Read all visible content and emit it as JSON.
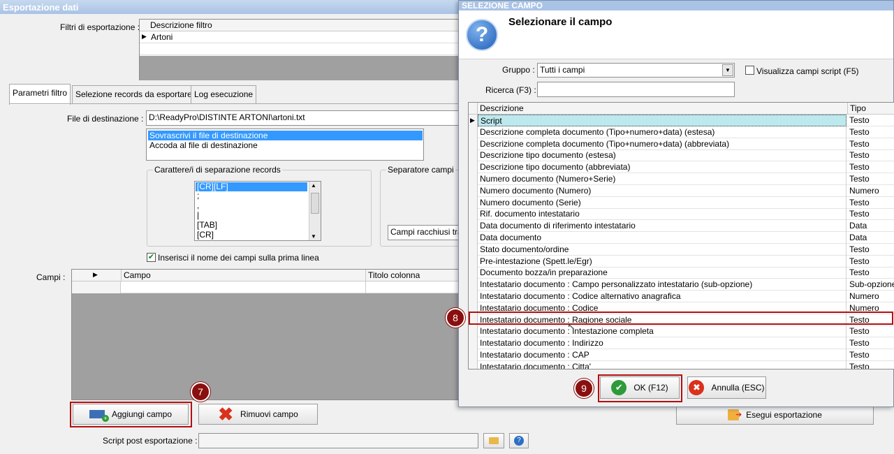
{
  "window": {
    "title": "Esportazione dati"
  },
  "filters": {
    "label": "Filtri di esportazione :",
    "column_header": "Descrizione filtro",
    "rows": [
      "Artoni"
    ]
  },
  "tabs": [
    "Parametri filtro",
    "Selezione records da esportare",
    "Log esecuzione"
  ],
  "destination": {
    "label": "File di destinazione :",
    "value": "D:\\ReadyPro\\DISTINTE ARTONI\\artoni.txt"
  },
  "write_mode": {
    "options": [
      "Sovrascrivi il file di destinazione",
      "Accoda al file di destinazione"
    ],
    "selected": "Sovrascrivi il file di destinazione"
  },
  "record_separator": {
    "title": "Carattere/i di separazione records",
    "items": [
      "[CR][LF]",
      ";",
      ",",
      "|",
      "[TAB]",
      "[CR]"
    ]
  },
  "field_separator": {
    "title": "Separatore campi",
    "enclosure_value": "Campi racchiusi tra"
  },
  "header_checkbox": {
    "label": "Inserisci il nome dei campi sulla prima linea",
    "checked": true
  },
  "fields": {
    "label": "Campi :",
    "columns": [
      "Campo",
      "Titolo colonna"
    ]
  },
  "buttons": {
    "add": "Aggiungi campo",
    "remove": "Rimuovi campo",
    "export": "Esegui esportazione"
  },
  "script_post": {
    "label": "Script post esportazione :"
  },
  "annotations": {
    "step7": "7",
    "step8": "8",
    "step9": "9"
  },
  "dialog": {
    "title": "SELEZIONE CAMPO",
    "heading": "Selezionare il campo",
    "group_label": "Gruppo :",
    "group_value": "Tutti i campi",
    "script_checkbox": "Visualizza campi script (F5)",
    "search_label": "Ricerca (F3) :",
    "columns": [
      "Descrizione",
      "Tipo"
    ],
    "rows": [
      {
        "desc": "Script",
        "type": "Testo"
      },
      {
        "desc": "Descrizione completa documento (Tipo+numero+data) (estesa)",
        "type": "Testo"
      },
      {
        "desc": "Descrizione completa documento (Tipo+numero+data) (abbreviata)",
        "type": "Testo"
      },
      {
        "desc": "Descrizione tipo documento (estesa)",
        "type": "Testo"
      },
      {
        "desc": "Descrizione tipo documento (abbreviata)",
        "type": "Testo"
      },
      {
        "desc": "Numero documento (Numero+Serie)",
        "type": "Testo"
      },
      {
        "desc": "Numero documento (Numero)",
        "type": "Numero"
      },
      {
        "desc": "Numero documento (Serie)",
        "type": "Testo"
      },
      {
        "desc": "Rif. documento intestatario",
        "type": "Testo"
      },
      {
        "desc": "Data documento di riferimento intestatario",
        "type": "Data"
      },
      {
        "desc": "Data documento",
        "type": "Data"
      },
      {
        "desc": "Stato documento/ordine",
        "type": "Testo"
      },
      {
        "desc": "Pre-intestazione (Spett.le/Egr)",
        "type": "Testo"
      },
      {
        "desc": "Documento bozza/in preparazione",
        "type": "Testo"
      },
      {
        "desc": "Intestatario documento : Campo personalizzato intestatario (sub-opzione)",
        "type": "Sub-opzione"
      },
      {
        "desc": "Intestatario documento : Codice alternativo anagrafica",
        "type": "Numero"
      },
      {
        "desc": "Intestatario documento : Codice",
        "type": "Numero"
      },
      {
        "desc": "Intestatario documento : Ragione sociale",
        "type": "Testo"
      },
      {
        "desc": "Intestatario documento : Intestazione completa",
        "type": "Testo"
      },
      {
        "desc": "Intestatario documento : Indirizzo",
        "type": "Testo"
      },
      {
        "desc": "Intestatario documento : CAP",
        "type": "Testo"
      },
      {
        "desc": "Intestatario documento : Citta'",
        "type": "Testo"
      }
    ],
    "ok": "OK (F12)",
    "cancel": "Annulla (ESC)"
  }
}
